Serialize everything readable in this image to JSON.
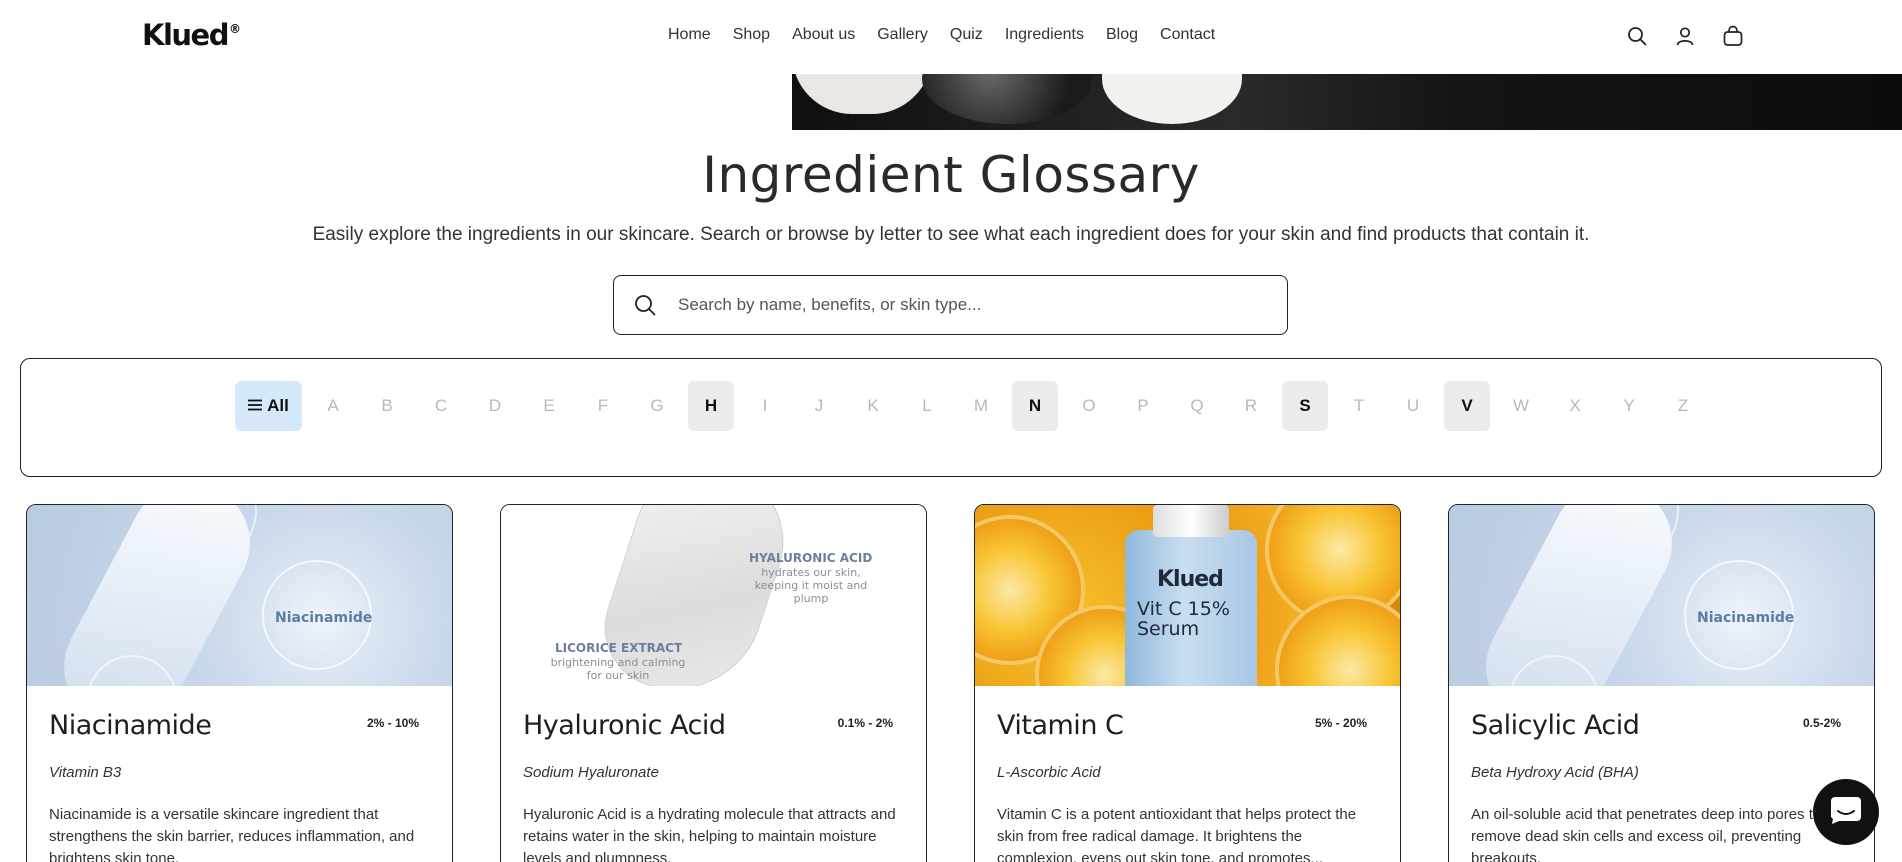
{
  "header": {
    "logo": "Klued",
    "logo_mark": "®",
    "nav": [
      {
        "label": "Home"
      },
      {
        "label": "Shop"
      },
      {
        "label": "About us"
      },
      {
        "label": "Gallery"
      },
      {
        "label": "Quiz"
      },
      {
        "label": "Ingredients"
      },
      {
        "label": "Blog"
      },
      {
        "label": "Contact"
      }
    ],
    "icons": [
      "search-icon",
      "account-icon",
      "cart-icon"
    ]
  },
  "page": {
    "title": "Ingredient Glossary",
    "subtitle": "Easily explore the ingredients in our skincare. Search or browse by letter to see what each ingredient does for your skin and find products that contain it."
  },
  "search": {
    "placeholder": "Search by name, benefits, or skin type..."
  },
  "filter": {
    "all_label": "All",
    "letters": [
      "A",
      "B",
      "C",
      "D",
      "E",
      "F",
      "G",
      "H",
      "I",
      "J",
      "K",
      "L",
      "M",
      "N",
      "O",
      "P",
      "Q",
      "R",
      "S",
      "T",
      "U",
      "V",
      "W",
      "X",
      "Y",
      "Z"
    ],
    "active_letters": [
      "H",
      "N",
      "S",
      "V"
    ]
  },
  "cards": [
    {
      "name": "Niacinamide",
      "percent": "2% - 10%",
      "scientific": "Vitamin B3",
      "description": "Niacinamide is a versatile skincare ingredient that strengthens the skin barrier, reduces inflammation, and brightens skin tone.",
      "image_label": "Niacinamide"
    },
    {
      "name": "Hyaluronic Acid",
      "percent": "0.1% - 2%",
      "scientific": "Sodium Hyaluronate",
      "description": "Hyaluronic Acid is a hydrating molecule that attracts and retains water in the skin, helping to maintain moisture levels and plumpness.",
      "image_label_1": "HYALURONIC ACID",
      "image_text_1": "hydrates our skin, keeping it moist and plump",
      "image_label_2": "LICORICE EXTRACT",
      "image_text_2": "brightening and calming for our skin"
    },
    {
      "name": "Vitamin C",
      "percent": "5% - 20%",
      "scientific": "L-Ascorbic Acid",
      "description": "Vitamin C is a potent antioxidant that helps protect the skin from free radical damage. It brightens the complexion, evens out skin tone, and promotes...",
      "image_brand": "Klued",
      "image_product": "Vit C 15% Serum"
    },
    {
      "name": "Salicylic Acid",
      "percent": "0.5-2%",
      "scientific": "Beta Hydroxy Acid (BHA)",
      "description": "An oil-soluble acid that penetrates deep into pores to remove dead skin cells and excess oil, preventing breakouts.",
      "image_label": "Niacinamide"
    }
  ],
  "colors": {
    "accent": "#d6e9fb",
    "text": "#1f1f1f",
    "inactive_letter": "#b8b8b8",
    "active_letter_bg": "#ececec"
  }
}
